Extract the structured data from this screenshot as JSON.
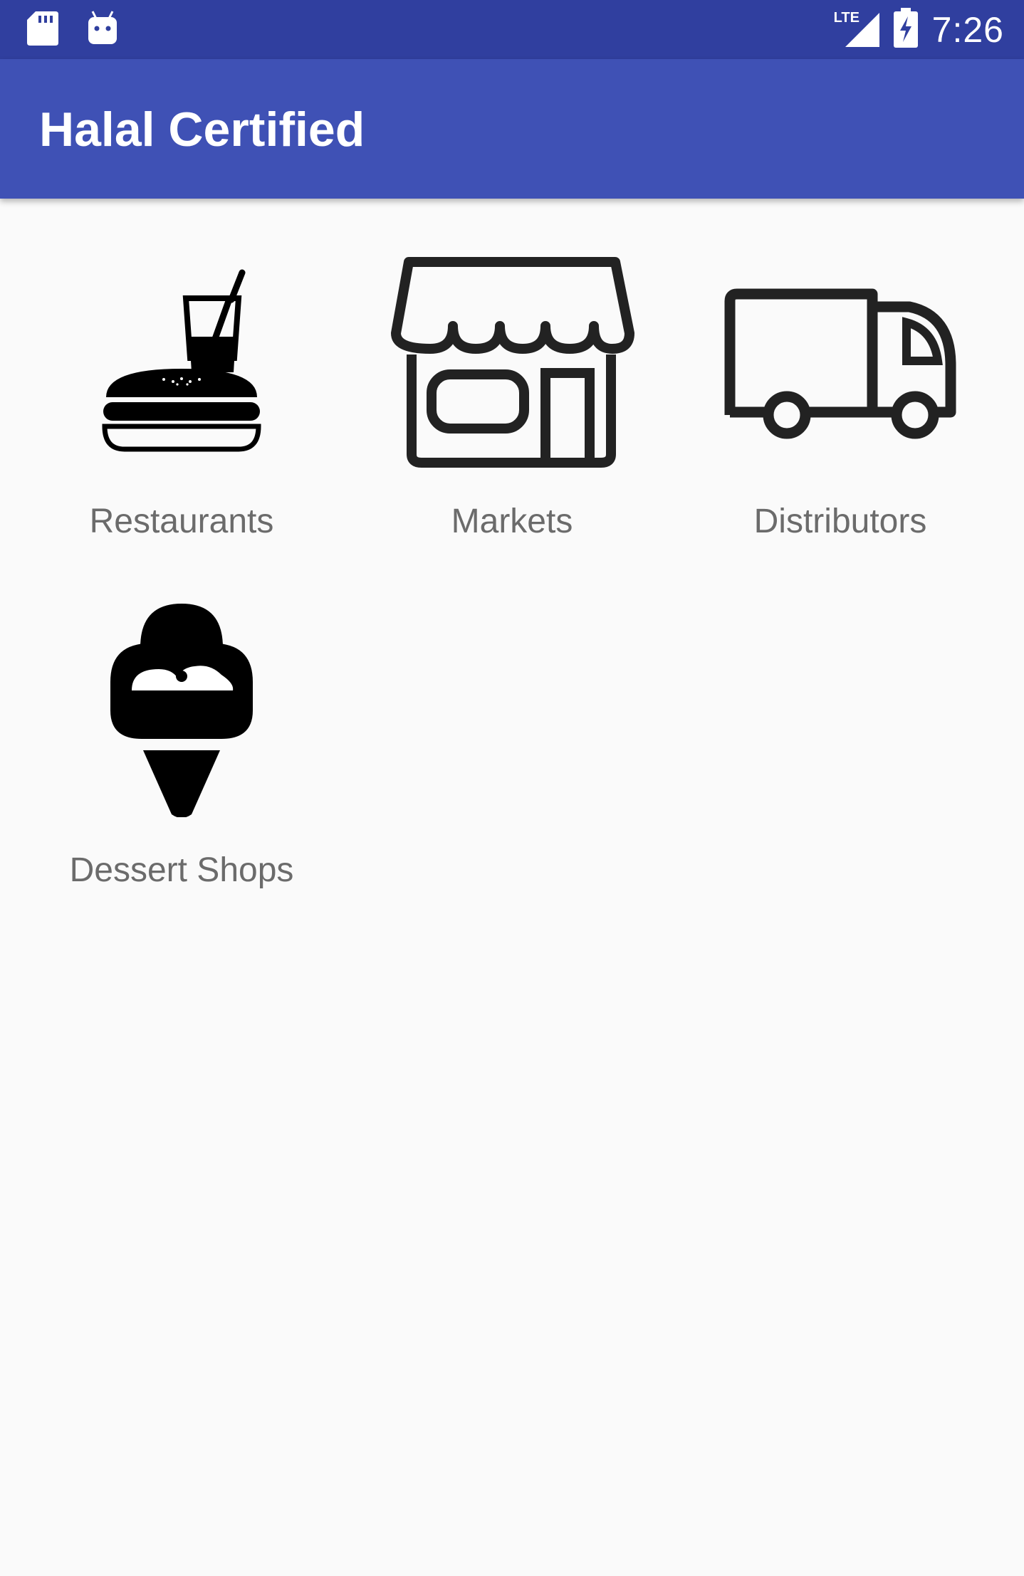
{
  "status_bar": {
    "time": "7:26",
    "network": "LTE",
    "icons": [
      "sd-card-icon",
      "android-icon",
      "signal-icon",
      "battery-charging-icon"
    ]
  },
  "app_bar": {
    "title": "Halal Certified",
    "color": "#3f51b5",
    "status_color": "#303f9f"
  },
  "categories": [
    {
      "label": "Restaurants",
      "icon": "burger-drink-icon"
    },
    {
      "label": "Markets",
      "icon": "storefront-icon"
    },
    {
      "label": "Distributors",
      "icon": "delivery-truck-icon"
    },
    {
      "label": "Dessert Shops",
      "icon": "ice-cream-icon"
    }
  ]
}
